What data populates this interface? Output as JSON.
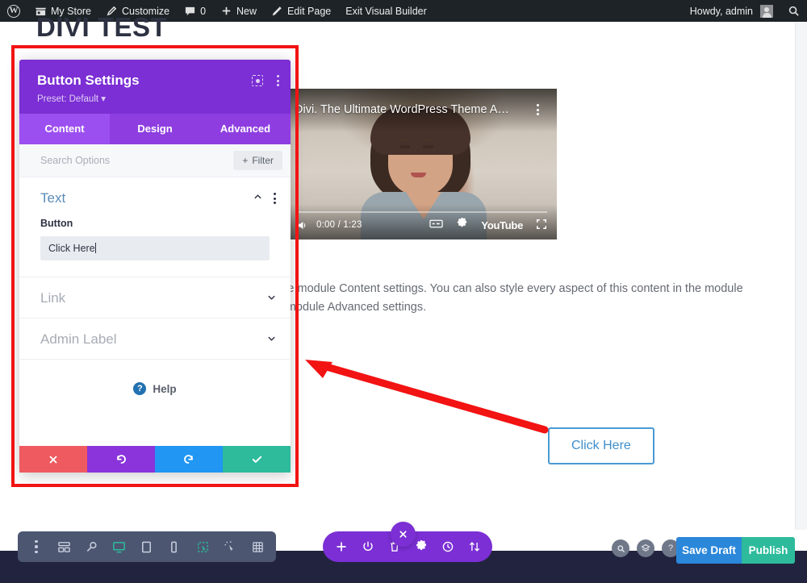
{
  "adminbar": {
    "wp_logo": "wordpress-logo",
    "items": [
      {
        "label": "My Store",
        "icon": "store-icon"
      },
      {
        "label": "Customize",
        "icon": "paintbrush-icon"
      },
      {
        "label": "0",
        "icon": "comment-icon"
      },
      {
        "label": "New",
        "icon": "plus-icon"
      },
      {
        "label": "Edit Page",
        "icon": "pencil-icon"
      },
      {
        "label": "Exit Visual Builder",
        "icon": ""
      }
    ],
    "howdy": "Howdy, admin",
    "search_icon": "search-icon"
  },
  "page": {
    "title": "DIVI TEST",
    "body_text": "e or in the module Content settings. You can also style every aspect of this content in the module ct in the module Advanced settings.",
    "cta_label": "Click Here"
  },
  "video": {
    "title": "Divi. The Ultimate WordPress Theme An...",
    "time": "0:00 / 1:23",
    "brand": "YouTube",
    "icons": [
      "volume-icon",
      "captions-icon",
      "settings-gear-icon",
      "fullscreen-icon",
      "kebab-menu-icon"
    ]
  },
  "panel": {
    "title": "Button Settings",
    "preset": "Preset: Default",
    "header_icons": [
      "focus-mode-icon",
      "kebab-menu-icon"
    ],
    "tabs": [
      {
        "label": "Content",
        "active": true
      },
      {
        "label": "Design",
        "active": false
      },
      {
        "label": "Advanced",
        "active": false
      }
    ],
    "search_placeholder": "Search Options",
    "filter_label": "Filter",
    "sections": [
      {
        "name": "Text",
        "open": true
      },
      {
        "name": "Link",
        "open": false
      },
      {
        "name": "Admin Label",
        "open": false
      }
    ],
    "field": {
      "label": "Button",
      "value": "Click Here"
    },
    "help_label": "Help",
    "actions": [
      {
        "name": "cancel",
        "glyph": "✖",
        "color": "#ee5a5f"
      },
      {
        "name": "undo",
        "glyph": "↺",
        "color": "#8b34db"
      },
      {
        "name": "redo",
        "glyph": "↻",
        "color": "#2196f3"
      },
      {
        "name": "save",
        "glyph": "✔",
        "color": "#2dbb9c"
      }
    ]
  },
  "bottom_bar": {
    "left_group": [
      "kebab-menu-icon",
      "wireframe-icon",
      "zoom-icon",
      "desktop-icon",
      "tablet-icon",
      "phone-icon"
    ],
    "left_group2": [
      "select-area-icon",
      "click-cursor-icon",
      "grid-icon"
    ],
    "center_group": [
      "add-icon",
      "power-icon",
      "trash-icon",
      "settings-gear-icon",
      "history-clock-icon",
      "sort-icon"
    ],
    "right_icons": [
      "search-icon",
      "layers-icon",
      "help-icon"
    ],
    "save_draft": "Save Draft",
    "publish": "Publish",
    "close_icon": "close-x-icon"
  },
  "colors": {
    "divi_purple": "#7b2fd4",
    "tab_purple": "#8e3ee0",
    "tab_active": "#9c4ff0",
    "annotation_red": "#f21313",
    "cta_blue": "#4a9ad4",
    "publish_green": "#2dbb9c",
    "draft_blue": "#2b87da",
    "adminbar_dark": "#1d2327",
    "bottom_dark": "#22243f",
    "toolbar_slate": "#4c5671"
  }
}
